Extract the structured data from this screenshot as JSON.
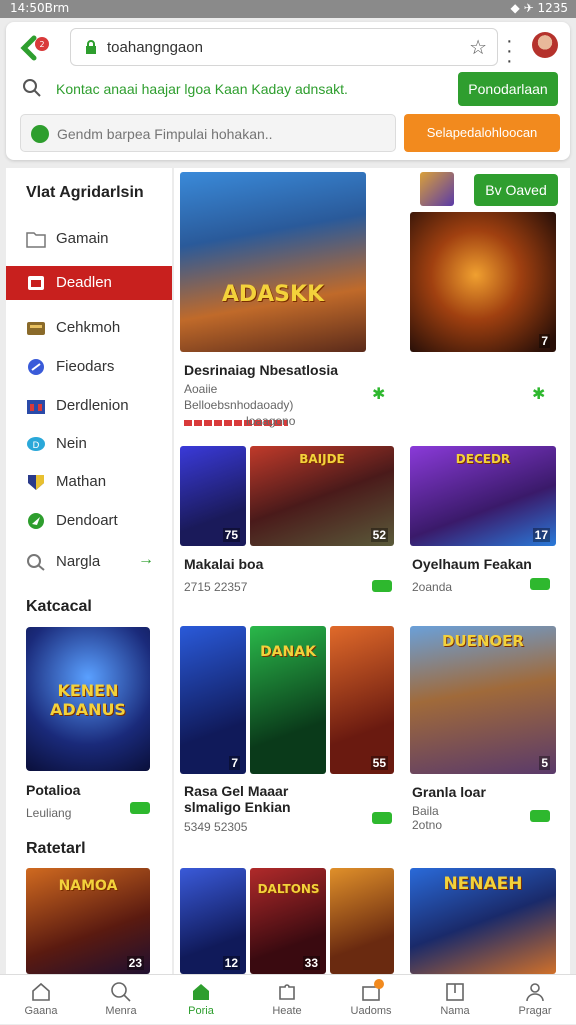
{
  "status_bar": {
    "time": "14:50Brm",
    "right": "◆ ✈ 1235"
  },
  "browser": {
    "url": "toahangngaon",
    "notice": "Kontac anaai haajar lgoa   Kaan   Kaday adnsakt.",
    "notice_button": "Ponodarlaan",
    "search_placeholder": "Gendm barpea Fimpulai hohakan..",
    "search_button": "Selapedalohloocan"
  },
  "sidebar": {
    "heading": "Vlat Agridarlsin",
    "items": [
      {
        "label": "Gamain",
        "icon": "folder-icon"
      },
      {
        "label": "Deadlen",
        "icon": "calendar-icon",
        "active": true
      },
      {
        "label": "Cehkmoh",
        "icon": "box-icon"
      },
      {
        "label": "Fieodars",
        "icon": "tag-icon"
      },
      {
        "label": "Derdlenion",
        "icon": "grid-icon"
      },
      {
        "label": "Nein",
        "icon": "chat-icon"
      },
      {
        "label": "Mathan",
        "icon": "shield-icon"
      },
      {
        "label": "Dendoart",
        "icon": "send-icon"
      },
      {
        "label": "Nargla",
        "icon": "search-icon"
      }
    ],
    "arrow": "→",
    "section1": {
      "heading": "Katcacal",
      "title": "Potalioa",
      "sub": "Leuliang",
      "art": "KENEN ADANUS"
    },
    "section2": {
      "heading": "Ratetarl",
      "art": "NAMOA",
      "num": "23"
    }
  },
  "main": {
    "save_button": "Bv Oaved",
    "featured": {
      "title": "Desrinaiag Nbesatlosia",
      "sub1": "Aoaiie",
      "sub2": "Belloebsnhodaoady)",
      "sub3": "loaagono",
      "art": "ADASKK"
    },
    "side_art": "",
    "side_num": "7",
    "row1": {
      "thumbs": [
        {
          "art": "",
          "num": "75"
        },
        {
          "art": "BAIJDE",
          "num": "52"
        },
        {
          "art": "DECEDR",
          "num": "17"
        }
      ],
      "left_title": "Makalai boa",
      "left_sub": "2715 22357",
      "right_title": "Oyelhaum Feakan",
      "right_sub": "2oanda"
    },
    "row2": {
      "thumbs": [
        {
          "art": "",
          "num": "7"
        },
        {
          "art": "DANAK",
          "num": "55"
        },
        {
          "art": "DUENOER",
          "num": "5"
        }
      ],
      "left_title": "Rasa Gel Maaar",
      "left_title2": "slmaligo Enkian",
      "left_sub": "5349 52305",
      "right_title": "Granla loar",
      "right_sub": "Baila",
      "right_sub2": "2otno"
    },
    "row3": {
      "thumbs": [
        {
          "art": "",
          "num": "12"
        },
        {
          "art": "DALTONS",
          "num": "33"
        },
        {
          "art": "",
          "num": ""
        },
        {
          "art": "NENAEH",
          "num": ""
        }
      ]
    }
  },
  "bottom_nav": [
    {
      "label": "Gaana",
      "icon": "home-icon"
    },
    {
      "label": "Menra",
      "icon": "search-icon"
    },
    {
      "label": "Poria",
      "icon": "house-active-icon",
      "active": true
    },
    {
      "label": "Heate",
      "icon": "puzzle-icon"
    },
    {
      "label": "Uadoms",
      "icon": "gift-icon",
      "badge": true
    },
    {
      "label": "Nama",
      "icon": "book-icon"
    },
    {
      "label": "Pragar",
      "icon": "profile-icon"
    }
  ],
  "colors": {
    "accent_green": "#2f9e2f",
    "accent_red": "#c8201e",
    "accent_orange": "#f28a1e"
  }
}
